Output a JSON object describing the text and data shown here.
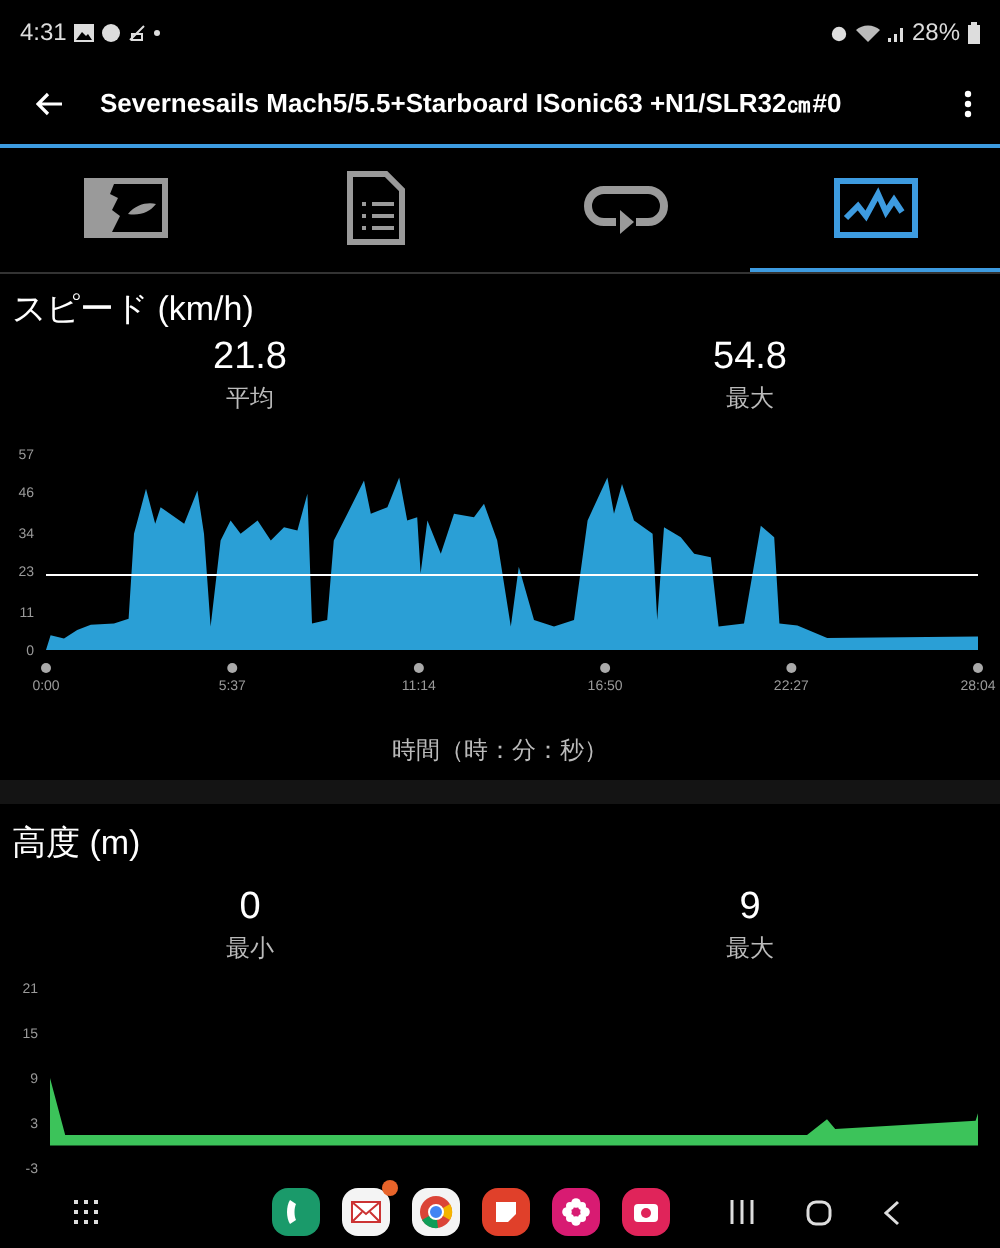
{
  "status_bar": {
    "time": "4:31",
    "battery": "28%"
  },
  "app_bar": {
    "title": "Severnesails Mach5/5.5+Starboard ISonic63 +N1/SLR32㎝#0"
  },
  "tabs": [
    {
      "kind": "map",
      "selected": false
    },
    {
      "kind": "document",
      "selected": false
    },
    {
      "kind": "repeat",
      "selected": false
    },
    {
      "kind": "graph",
      "selected": true
    }
  ],
  "speed": {
    "title": "スピード (km/h)",
    "stats": [
      {
        "value": "21.8",
        "label": "平均"
      },
      {
        "value": "54.8",
        "label": "最大"
      }
    ],
    "chart_data": {
      "type": "area",
      "xlabel": "時間（時：分：秒）",
      "xlim": [
        0,
        28.07
      ],
      "ylim": [
        0,
        57
      ],
      "x": [
        0,
        0.14,
        0.54,
        0.94,
        1.35,
        2.05,
        2.49,
        2.65,
        3.01,
        3.29,
        3.45,
        4.16,
        4.56,
        4.76,
        4.96,
        5.26,
        5.56,
        5.86,
        6.37,
        6.77,
        7.17,
        7.57,
        7.87,
        8.01,
        8.47,
        8.67,
        9.08,
        9.58,
        9.78,
        10.28,
        10.64,
        10.88,
        11.18,
        11.28,
        11.49,
        11.89,
        12.29,
        12.89,
        13.19,
        13.59,
        14.0,
        14.24,
        14.7,
        15.3,
        15.9,
        16.31,
        16.91,
        17.11,
        17.35,
        17.71,
        18.27,
        18.41,
        18.61,
        19.12,
        19.52,
        20.02,
        20.26,
        21.02,
        21.53,
        21.93,
        22.09,
        22.63,
        23.53,
        28.07
      ],
      "series": [
        {
          "color": "#2a9fd6",
          "values": [
            0,
            4.3,
            3.3,
            5.8,
            7.3,
            7.7,
            9.1,
            33.8,
            46.9,
            36.7,
            41.5,
            36.7,
            46.4,
            33.8,
            6.8,
            31.9,
            37.7,
            33.8,
            37.7,
            31.9,
            35.7,
            34.8,
            45.4,
            7.7,
            8.7,
            31.9,
            39.6,
            49.3,
            39.6,
            41.5,
            50.2,
            37.7,
            38.6,
            22.2,
            37.7,
            28.0,
            39.6,
            38.6,
            42.5,
            31.9,
            6.8,
            24.2,
            8.7,
            6.8,
            8.7,
            37.7,
            50.2,
            39.6,
            48.3,
            37.7,
            33.8,
            8.7,
            35.7,
            32.8,
            28.0,
            27.0,
            6.8,
            7.7,
            36.1,
            32.8,
            7.7,
            7.1,
            3.5,
            3.9
          ]
        }
      ],
      "xticks": [
        {
          "value": 0,
          "label": "0:00"
        },
        {
          "value": 5.61,
          "label": "5:37"
        },
        {
          "value": 11.23,
          "label": "11:14"
        },
        {
          "value": 16.84,
          "label": "16:50"
        },
        {
          "value": 22.45,
          "label": "22:27"
        },
        {
          "value": 28.07,
          "label": "28:04"
        }
      ],
      "yticks": [
        0,
        11,
        23,
        34,
        46,
        57
      ]
    }
  },
  "altitude": {
    "title": "高度 (m)",
    "stats": [
      {
        "value": "0",
        "label": "最小"
      },
      {
        "value": "9",
        "label": "最大"
      }
    ],
    "chart_data": {
      "type": "area",
      "xlim": [
        0,
        28.07
      ],
      "ylim": [
        -3,
        21
      ],
      "x": [
        0,
        0.46,
        22.9,
        23.5,
        23.75,
        28.0,
        28.07
      ],
      "series": [
        {
          "color": "#3cc35a",
          "values": [
            9,
            1.4,
            1.4,
            3.5,
            2.2,
            3.3,
            4.3
          ]
        }
      ],
      "yticks": [
        21,
        15,
        9,
        3,
        -3
      ]
    }
  },
  "nav_bar": {
    "apps": [
      {
        "kind": "phone",
        "color": "#1a9a6a",
        "badge": false
      },
      {
        "kind": "mail",
        "color": "#f4f4f4",
        "badge": true
      },
      {
        "kind": "browser",
        "color": "#f4f4f4",
        "badge": false
      },
      {
        "kind": "notes",
        "color": "#e0402a",
        "badge": false
      },
      {
        "kind": "flower",
        "color": "#d81b72",
        "badge": false
      },
      {
        "kind": "camera",
        "color": "#e0245a",
        "badge": false
      }
    ]
  }
}
